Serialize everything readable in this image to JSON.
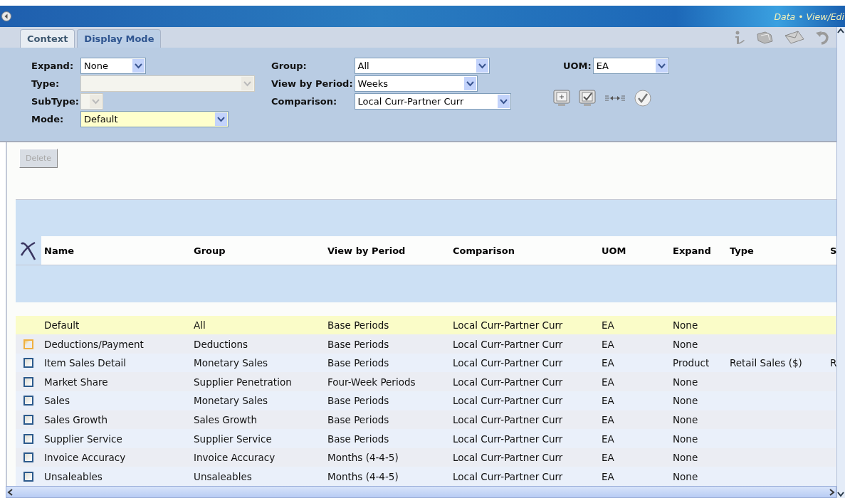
{
  "title_bar": {
    "breadcrumb": "Data • View/Edi"
  },
  "tabs": [
    {
      "label": "Context",
      "selected": false
    },
    {
      "label": "Display Mode",
      "selected": true
    }
  ],
  "filter_groups": [
    {
      "fields": [
        {
          "label": "Expand:",
          "value": "None",
          "disabled": false,
          "highlighted": false
        },
        {
          "label": "Type:",
          "disabled": true,
          "highlighted": false
        },
        {
          "label": "SubType:",
          "disabled": true,
          "highlighted": false
        },
        {
          "label": "Mode:",
          "value": "Default",
          "disabled": false,
          "highlighted": true
        }
      ]
    },
    {
      "fields": [
        {
          "label": "Group:",
          "value": "All",
          "disabled": false,
          "highlighted": false
        },
        {
          "label": "View by Period:",
          "value": "Weeks",
          "disabled": false,
          "highlighted": false
        },
        {
          "label": "Comparison:",
          "value": "Local Curr-Partner Curr",
          "disabled": false,
          "highlighted": false
        }
      ]
    },
    {
      "fields": [
        {
          "label": "UOM:",
          "value": "EA",
          "disabled": false,
          "highlighted": false
        }
      ]
    }
  ],
  "delete_button": {
    "label": "Delete",
    "disabled": true
  },
  "table": {
    "columns": [
      "Name",
      "Group",
      "View by Period",
      "Comparison",
      "UOM",
      "Expand",
      "Type",
      "S"
    ],
    "rows": [
      {
        "kind": "default",
        "selected": true,
        "name": "Default",
        "group": "All",
        "view_by_period": "Base Periods",
        "comparison": "Local Curr-Partner Curr",
        "uom": "EA",
        "expand": "None"
      },
      {
        "kind": "item",
        "selected": false,
        "checked": false,
        "focused": true,
        "name": "Deductions/Payment",
        "group": "Deductions",
        "view_by_period": "Base Periods",
        "comparison": "Local Curr-Partner Curr",
        "uom": "EA",
        "expand": "None"
      },
      {
        "kind": "item",
        "selected": false,
        "checked": false,
        "focused": false,
        "name": "Item Sales Detail",
        "group": "Monetary Sales",
        "view_by_period": "Base Periods",
        "comparison": "Local Curr-Partner Curr",
        "uom": "EA",
        "expand": "Product",
        "type": "Retail Sales ($)",
        "column_9": "R"
      },
      {
        "kind": "item",
        "selected": false,
        "checked": false,
        "focused": false,
        "name": "Market Share",
        "group": "Supplier Penetration",
        "view_by_period": "Four-Week Periods",
        "comparison": "Local Curr-Partner Curr",
        "uom": "EA",
        "expand": "None"
      },
      {
        "kind": "item",
        "selected": false,
        "checked": false,
        "focused": false,
        "name": "Sales",
        "group": "Monetary Sales",
        "view_by_period": "Base Periods",
        "comparison": "Local Curr-Partner Curr",
        "uom": "EA",
        "expand": "None"
      },
      {
        "kind": "item",
        "selected": false,
        "checked": false,
        "focused": false,
        "name": "Sales Growth",
        "group": "Sales Growth",
        "view_by_period": "Base Periods",
        "comparison": "Local Curr-Partner Curr",
        "uom": "EA",
        "expand": "None"
      },
      {
        "kind": "item",
        "selected": false,
        "checked": false,
        "focused": false,
        "name": "Supplier Service",
        "group": "Supplier Service",
        "view_by_period": "Base Periods",
        "comparison": "Local Curr-Partner Curr",
        "uom": "EA",
        "expand": "None"
      },
      {
        "kind": "item",
        "selected": false,
        "checked": false,
        "focused": false,
        "name": "Invoice Accuracy",
        "group": "Invoice Accuracy",
        "view_by_period": "Months (4-4-5)",
        "comparison": "Local Curr-Partner Curr",
        "uom": "EA",
        "expand": "None"
      },
      {
        "kind": "item",
        "selected": false,
        "checked": false,
        "focused": false,
        "name": "Unsaleables",
        "group": "Unsaleables",
        "view_by_period": "Months (4-4-5)",
        "comparison": "Local Curr-Partner Curr",
        "uom": "EA",
        "expand": "None"
      }
    ]
  }
}
